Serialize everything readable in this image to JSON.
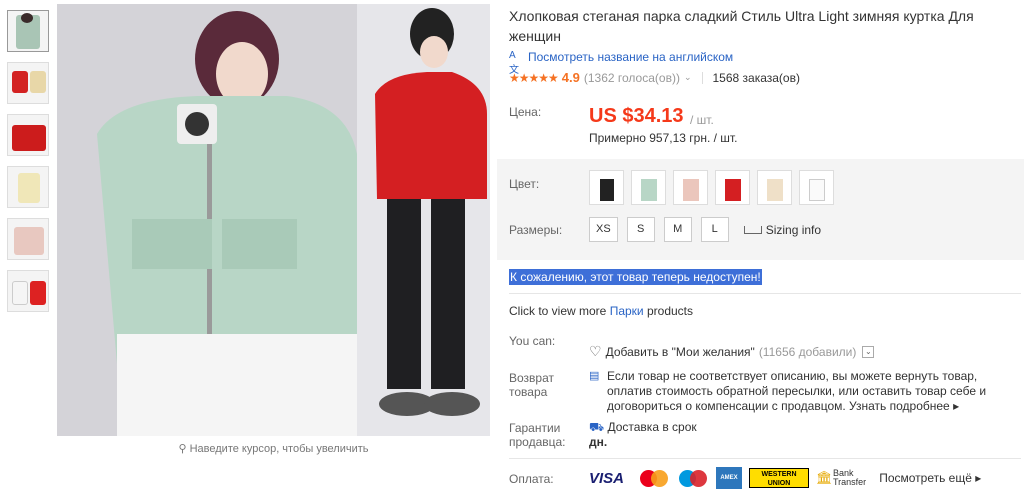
{
  "product": {
    "title": "Хлопковая стеганая парка сладкий Стиль Ultra Light зимняя куртка Для женщин",
    "translate_link": "Посмотреть название на английском",
    "rating": {
      "stars": "★★★★★",
      "value": "4.9",
      "votes": "(1362 голоса(ов))",
      "orders": "1568 заказа(ов)"
    }
  },
  "price": {
    "label": "Цена:",
    "value": "US $34.13",
    "unit": "/ шт.",
    "approx": "Примерно 957,13 грн. / шт."
  },
  "options": {
    "color_label": "Цвет:",
    "size_label": "Размеры:",
    "sizes": [
      "XS",
      "S",
      "M",
      "L"
    ],
    "sizing_info": "Sizing info"
  },
  "unavailable": "К сожалению, этот товар теперь недоступен!",
  "more_products": {
    "prefix": "Click to view more",
    "link": "Парки",
    "suffix": "products"
  },
  "actions": {
    "you_can_label": "You can:",
    "wishlist": "Добавить в \"Мои желания\"",
    "wishlist_count": "(11656 добавили)"
  },
  "returns": {
    "label_line1": "Возврат",
    "label_line2": "товара",
    "text": "Если товар не соответствует описанию, вы можете вернуть товар, оплатив стоимость обратной пересылки, или оставить товар себе и договориться о компенсации с продавцом.",
    "link": "Узнать подробнее"
  },
  "guarantee": {
    "label_line1": "Гарантии",
    "label_line2": "продавца:",
    "line1": "Доставка в срок",
    "line2": "дн."
  },
  "payment": {
    "label": "Оплата:",
    "visa": "VISA",
    "amex": "AMEX",
    "wu_line1": "WESTERN",
    "wu_line2": "UNION",
    "bank_line1": "Bank",
    "bank_line2": "Transfer",
    "see_all": "Посмотреть ещё"
  },
  "image": {
    "zoom_hint": "Наведите курсор, чтобы увеличить"
  },
  "colors": {
    "price": "#f5391a",
    "rating": "#f57224",
    "link": "#2a64c5",
    "highlight": "#3e6fd8"
  }
}
